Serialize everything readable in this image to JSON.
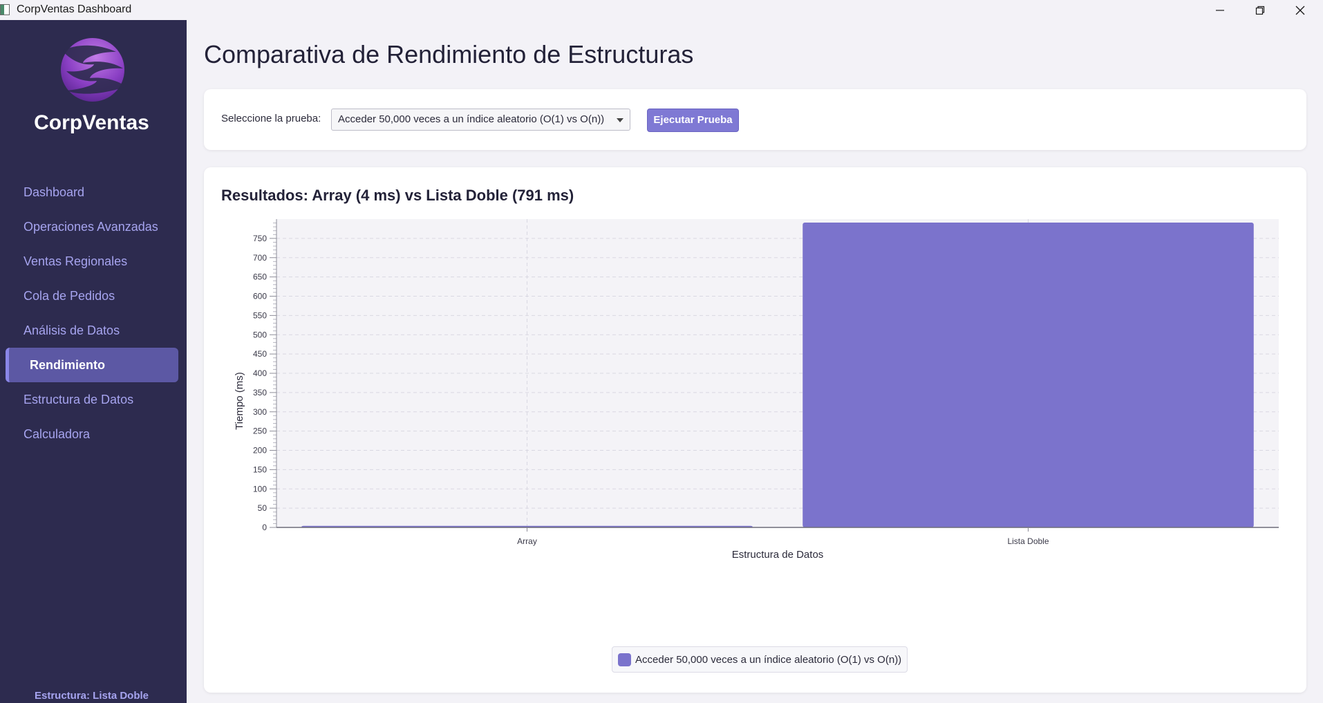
{
  "window": {
    "title": "CorpVentas Dashboard"
  },
  "sidebar": {
    "brand": "CorpVentas",
    "items": [
      {
        "label": "Dashboard",
        "active": false
      },
      {
        "label": "Operaciones Avanzadas",
        "active": false
      },
      {
        "label": "Ventas Regionales",
        "active": false
      },
      {
        "label": "Cola de Pedidos",
        "active": false
      },
      {
        "label": "Análisis de Datos",
        "active": false
      },
      {
        "label": "Rendimiento",
        "active": true
      },
      {
        "label": "Estructura de Datos",
        "active": false
      },
      {
        "label": "Calculadora",
        "active": false
      }
    ],
    "footer": "Estructura: Lista Doble"
  },
  "page": {
    "title": "Comparativa de Rendimiento de Estructuras"
  },
  "controls": {
    "label": "Seleccione la prueba:",
    "selected_test": "Acceder 50,000 veces a un índice aleatorio (O(1) vs O(n))",
    "run_label": "Ejecutar Prueba"
  },
  "results": {
    "title": "Resultados: Array (4 ms) vs Lista Doble (791 ms)"
  },
  "colors": {
    "bar": "#7b73cc",
    "sidebar": "#2d2b4f",
    "accent": "#7f79d4"
  },
  "chart_data": {
    "type": "bar",
    "categories": [
      "Array",
      "Lista Doble"
    ],
    "series": [
      {
        "name": "Acceder 50,000 veces a un índice aleatorio (O(1) vs O(n))",
        "values": [
          4,
          791
        ]
      }
    ],
    "xlabel": "Estructura de Datos",
    "ylabel": "Tiempo (ms)",
    "ylim": [
      0,
      800
    ],
    "yticks": [
      0,
      50,
      100,
      150,
      200,
      250,
      300,
      350,
      400,
      450,
      500,
      550,
      600,
      650,
      700,
      750
    ],
    "grid": true,
    "legend": "bottom-center"
  }
}
